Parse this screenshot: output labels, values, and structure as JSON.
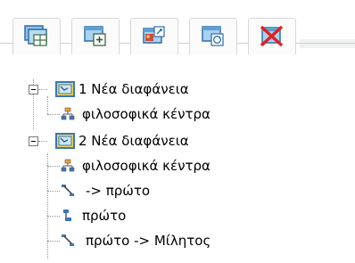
{
  "toolbar": {
    "buttons": [
      {
        "icon": "new-slide-grid-icon"
      },
      {
        "icon": "add-node-icon"
      },
      {
        "icon": "image-edit-icon"
      },
      {
        "icon": "refresh-node-icon"
      },
      {
        "icon": "delete-icon"
      }
    ],
    "accent_color": "#e3e3e3"
  },
  "tree": {
    "slides": [
      {
        "label": "1 Νέα διαφάνεια",
        "icon": "slide-icon",
        "expanded": true,
        "children": [
          {
            "label": "φιλοσοφικά κέντρα",
            "icon": "hierarchy-icon"
          }
        ]
      },
      {
        "label": "2 Νέα διαφάνεια",
        "icon": "slide-icon",
        "expanded": true,
        "children": [
          {
            "label": "φιλοσοφικά κέντρα",
            "icon": "hierarchy-icon"
          },
          {
            "label": "-> πρώτο",
            "icon": "link-arrow-icon"
          },
          {
            "label": "πρώτο",
            "icon": "node-icon"
          },
          {
            "label": "πρώτο -> Μίλητος",
            "icon": "link-arrow-icon"
          }
        ]
      }
    ]
  }
}
